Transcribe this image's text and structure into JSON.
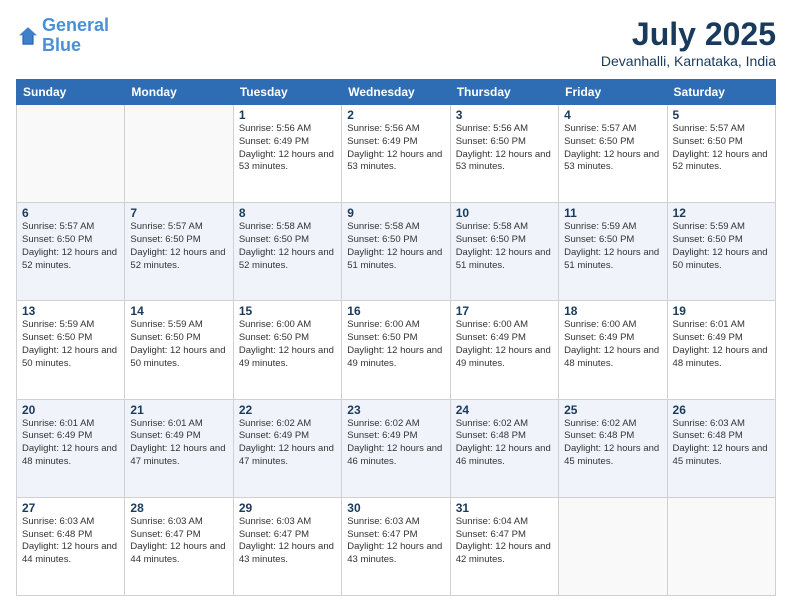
{
  "header": {
    "logo_line1": "General",
    "logo_line2": "Blue",
    "month": "July 2025",
    "location": "Devanhalli, Karnataka, India"
  },
  "days_of_week": [
    "Sunday",
    "Monday",
    "Tuesday",
    "Wednesday",
    "Thursday",
    "Friday",
    "Saturday"
  ],
  "weeks": [
    [
      {
        "day": "",
        "sunrise": "",
        "sunset": "",
        "daylight": ""
      },
      {
        "day": "",
        "sunrise": "",
        "sunset": "",
        "daylight": ""
      },
      {
        "day": "1",
        "sunrise": "Sunrise: 5:56 AM",
        "sunset": "Sunset: 6:49 PM",
        "daylight": "Daylight: 12 hours and 53 minutes."
      },
      {
        "day": "2",
        "sunrise": "Sunrise: 5:56 AM",
        "sunset": "Sunset: 6:49 PM",
        "daylight": "Daylight: 12 hours and 53 minutes."
      },
      {
        "day": "3",
        "sunrise": "Sunrise: 5:56 AM",
        "sunset": "Sunset: 6:50 PM",
        "daylight": "Daylight: 12 hours and 53 minutes."
      },
      {
        "day": "4",
        "sunrise": "Sunrise: 5:57 AM",
        "sunset": "Sunset: 6:50 PM",
        "daylight": "Daylight: 12 hours and 53 minutes."
      },
      {
        "day": "5",
        "sunrise": "Sunrise: 5:57 AM",
        "sunset": "Sunset: 6:50 PM",
        "daylight": "Daylight: 12 hours and 52 minutes."
      }
    ],
    [
      {
        "day": "6",
        "sunrise": "Sunrise: 5:57 AM",
        "sunset": "Sunset: 6:50 PM",
        "daylight": "Daylight: 12 hours and 52 minutes."
      },
      {
        "day": "7",
        "sunrise": "Sunrise: 5:57 AM",
        "sunset": "Sunset: 6:50 PM",
        "daylight": "Daylight: 12 hours and 52 minutes."
      },
      {
        "day": "8",
        "sunrise": "Sunrise: 5:58 AM",
        "sunset": "Sunset: 6:50 PM",
        "daylight": "Daylight: 12 hours and 52 minutes."
      },
      {
        "day": "9",
        "sunrise": "Sunrise: 5:58 AM",
        "sunset": "Sunset: 6:50 PM",
        "daylight": "Daylight: 12 hours and 51 minutes."
      },
      {
        "day": "10",
        "sunrise": "Sunrise: 5:58 AM",
        "sunset": "Sunset: 6:50 PM",
        "daylight": "Daylight: 12 hours and 51 minutes."
      },
      {
        "day": "11",
        "sunrise": "Sunrise: 5:59 AM",
        "sunset": "Sunset: 6:50 PM",
        "daylight": "Daylight: 12 hours and 51 minutes."
      },
      {
        "day": "12",
        "sunrise": "Sunrise: 5:59 AM",
        "sunset": "Sunset: 6:50 PM",
        "daylight": "Daylight: 12 hours and 50 minutes."
      }
    ],
    [
      {
        "day": "13",
        "sunrise": "Sunrise: 5:59 AM",
        "sunset": "Sunset: 6:50 PM",
        "daylight": "Daylight: 12 hours and 50 minutes."
      },
      {
        "day": "14",
        "sunrise": "Sunrise: 5:59 AM",
        "sunset": "Sunset: 6:50 PM",
        "daylight": "Daylight: 12 hours and 50 minutes."
      },
      {
        "day": "15",
        "sunrise": "Sunrise: 6:00 AM",
        "sunset": "Sunset: 6:50 PM",
        "daylight": "Daylight: 12 hours and 49 minutes."
      },
      {
        "day": "16",
        "sunrise": "Sunrise: 6:00 AM",
        "sunset": "Sunset: 6:50 PM",
        "daylight": "Daylight: 12 hours and 49 minutes."
      },
      {
        "day": "17",
        "sunrise": "Sunrise: 6:00 AM",
        "sunset": "Sunset: 6:49 PM",
        "daylight": "Daylight: 12 hours and 49 minutes."
      },
      {
        "day": "18",
        "sunrise": "Sunrise: 6:00 AM",
        "sunset": "Sunset: 6:49 PM",
        "daylight": "Daylight: 12 hours and 48 minutes."
      },
      {
        "day": "19",
        "sunrise": "Sunrise: 6:01 AM",
        "sunset": "Sunset: 6:49 PM",
        "daylight": "Daylight: 12 hours and 48 minutes."
      }
    ],
    [
      {
        "day": "20",
        "sunrise": "Sunrise: 6:01 AM",
        "sunset": "Sunset: 6:49 PM",
        "daylight": "Daylight: 12 hours and 48 minutes."
      },
      {
        "day": "21",
        "sunrise": "Sunrise: 6:01 AM",
        "sunset": "Sunset: 6:49 PM",
        "daylight": "Daylight: 12 hours and 47 minutes."
      },
      {
        "day": "22",
        "sunrise": "Sunrise: 6:02 AM",
        "sunset": "Sunset: 6:49 PM",
        "daylight": "Daylight: 12 hours and 47 minutes."
      },
      {
        "day": "23",
        "sunrise": "Sunrise: 6:02 AM",
        "sunset": "Sunset: 6:49 PM",
        "daylight": "Daylight: 12 hours and 46 minutes."
      },
      {
        "day": "24",
        "sunrise": "Sunrise: 6:02 AM",
        "sunset": "Sunset: 6:48 PM",
        "daylight": "Daylight: 12 hours and 46 minutes."
      },
      {
        "day": "25",
        "sunrise": "Sunrise: 6:02 AM",
        "sunset": "Sunset: 6:48 PM",
        "daylight": "Daylight: 12 hours and 45 minutes."
      },
      {
        "day": "26",
        "sunrise": "Sunrise: 6:03 AM",
        "sunset": "Sunset: 6:48 PM",
        "daylight": "Daylight: 12 hours and 45 minutes."
      }
    ],
    [
      {
        "day": "27",
        "sunrise": "Sunrise: 6:03 AM",
        "sunset": "Sunset: 6:48 PM",
        "daylight": "Daylight: 12 hours and 44 minutes."
      },
      {
        "day": "28",
        "sunrise": "Sunrise: 6:03 AM",
        "sunset": "Sunset: 6:47 PM",
        "daylight": "Daylight: 12 hours and 44 minutes."
      },
      {
        "day": "29",
        "sunrise": "Sunrise: 6:03 AM",
        "sunset": "Sunset: 6:47 PM",
        "daylight": "Daylight: 12 hours and 43 minutes."
      },
      {
        "day": "30",
        "sunrise": "Sunrise: 6:03 AM",
        "sunset": "Sunset: 6:47 PM",
        "daylight": "Daylight: 12 hours and 43 minutes."
      },
      {
        "day": "31",
        "sunrise": "Sunrise: 6:04 AM",
        "sunset": "Sunset: 6:47 PM",
        "daylight": "Daylight: 12 hours and 42 minutes."
      },
      {
        "day": "",
        "sunrise": "",
        "sunset": "",
        "daylight": ""
      },
      {
        "day": "",
        "sunrise": "",
        "sunset": "",
        "daylight": ""
      }
    ]
  ]
}
